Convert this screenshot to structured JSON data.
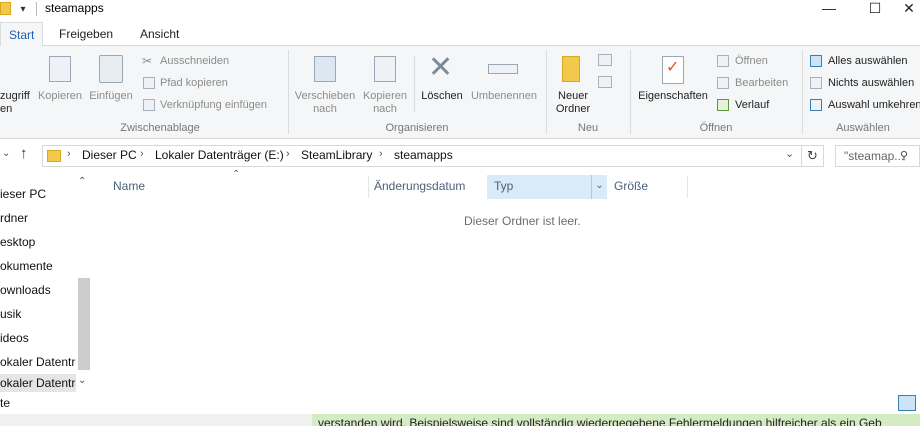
{
  "window": {
    "title": "steamapps",
    "qa_glyph": "▾",
    "controls": {
      "minimize": "—",
      "maximize": "☐",
      "close": "✕"
    }
  },
  "tabs": [
    {
      "label": "Start",
      "active": true
    },
    {
      "label": "Freigeben",
      "active": false
    },
    {
      "label": "Ansicht",
      "active": false
    }
  ],
  "ribbon": {
    "zwischenablage": {
      "label": "Zwischenablage",
      "pin_line1": "zugriff",
      "pin_line2": "en",
      "copy": "Kopieren",
      "paste": "Einfügen",
      "cut": "Ausschneiden",
      "copy_path": "Pfad kopieren",
      "paste_shortcut": "Verknüpfung einfügen"
    },
    "organisieren": {
      "label": "Organisieren",
      "move_line1": "Verschieben",
      "move_line2": "nach",
      "copyto_line1": "Kopieren",
      "copyto_line2": "nach",
      "delete": "Löschen",
      "rename": "Umbenennen"
    },
    "neu": {
      "label": "Neu",
      "new_folder_line1": "Neuer",
      "new_folder_line2": "Ordner"
    },
    "oeffnen": {
      "label": "Öffnen",
      "properties": "Eigenschaften",
      "open": "Öffnen",
      "edit": "Bearbeiten",
      "history": "Verlauf"
    },
    "auswaehlen": {
      "label": "Auswählen",
      "select_all": "Alles auswählen",
      "select_none": "Nichts auswählen",
      "invert": "Auswahl umkehren"
    }
  },
  "navbar": {
    "breadcrumb": [
      "Dieser PC",
      "Lokaler Datenträger (E:)",
      "SteamLibrary",
      "steamapps"
    ],
    "search_placeholder": "\"steamap...",
    "chevron": "›"
  },
  "nav_pane": {
    "items": [
      {
        "label": "ieser PC"
      },
      {
        "label": "rdner"
      },
      {
        "label": "esktop"
      },
      {
        "label": "okumente"
      },
      {
        "label": "ownloads"
      },
      {
        "label": "usik"
      },
      {
        "label": "ideos"
      },
      {
        "label": "okaler Datenträ"
      },
      {
        "label": "okaler Datenträ"
      }
    ],
    "bottom_fragment": "te"
  },
  "columns": [
    "Name",
    "Änderungsdatum",
    "Typ",
    "Größe"
  ],
  "empty_message": "Dieser Ordner ist leer.",
  "background_text": "verstanden wird. Beispielsweise sind vollständig wiedergegebene Fehlermeldungen hilfreicher als ein  Geb",
  "colors": {
    "accent": "#1a5fb4",
    "selected_header": "#d9ebf9",
    "folder": "#f2c94c"
  }
}
